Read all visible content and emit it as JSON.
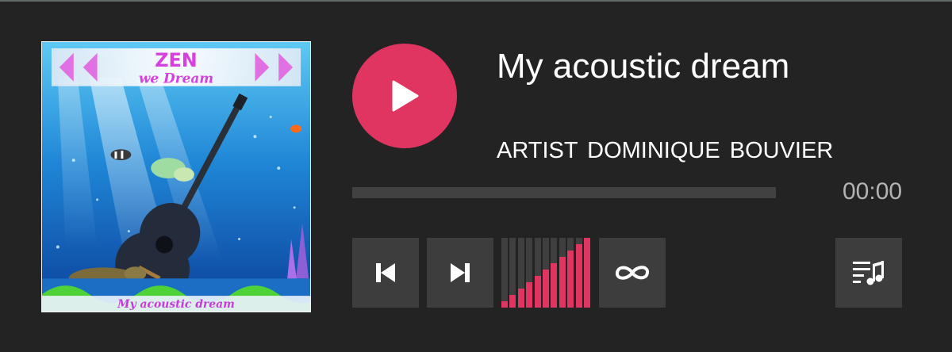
{
  "track": {
    "title": "My acoustic dream",
    "artist_line": "ARTIST  DOMINIQUE  BOUVIER",
    "time": "00:00",
    "progress": 0
  },
  "cover": {
    "logo_line1": "ZEN",
    "logo_line2": "we Dream",
    "caption": "My acoustic dream"
  },
  "volume": {
    "level": 1.0,
    "bar_count": 11
  },
  "icons": {
    "play": "play-icon",
    "prev": "skip-previous-icon",
    "next": "skip-next-icon",
    "loop": "infinity-loop-icon",
    "playlist": "playlist-music-icon"
  },
  "colors": {
    "accent": "#e03561",
    "background": "#232323",
    "button": "#3d3d3d",
    "track": "#414141",
    "text": "#ffffff",
    "muted": "#b3b3b3"
  }
}
